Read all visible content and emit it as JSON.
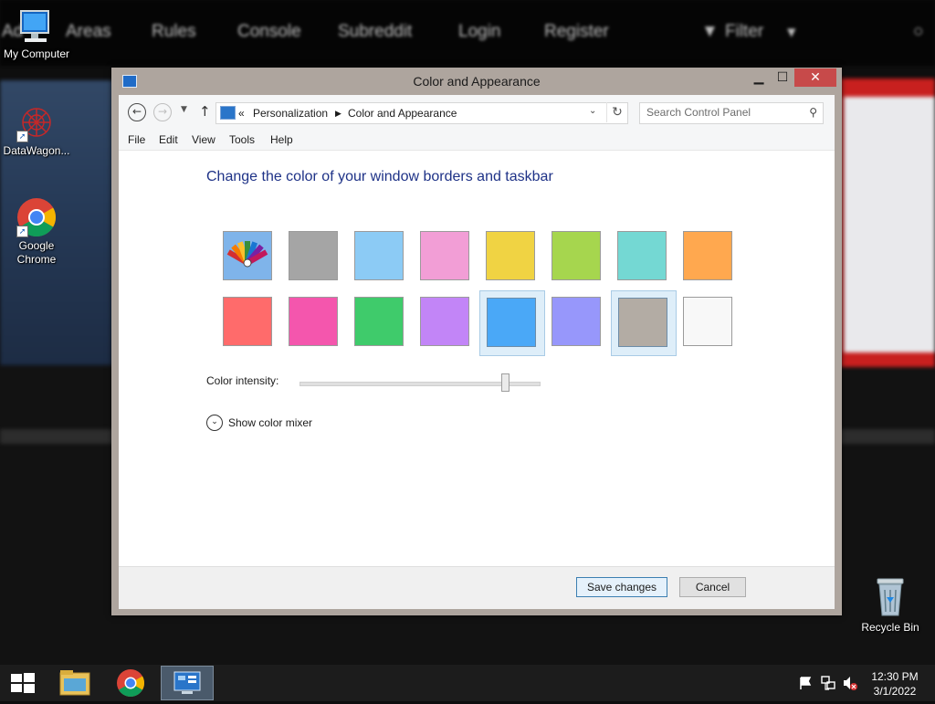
{
  "background": {
    "nav_items": [
      "Ad",
      "Areas",
      "Rules",
      "Console",
      "Subreddit",
      "Login",
      "Register",
      "Filter"
    ]
  },
  "desktop_icons": {
    "my_computer": "My Computer",
    "datawagon": "DataWagon...",
    "chrome": "Google Chrome",
    "recycle_bin": "Recycle Bin"
  },
  "window": {
    "title": "Color and Appearance",
    "address": {
      "chevron": "«",
      "crumb1": "Personalization",
      "crumb2": "Color and Appearance"
    },
    "search": {
      "placeholder": "Search Control Panel"
    },
    "menu": [
      "File",
      "Edit",
      "View",
      "Tools",
      "Help"
    ],
    "heading": "Change the color of your window borders and taskbar",
    "swatches": {
      "row1": [
        "auto",
        "#a5a5a5",
        "#8ccbf5",
        "#f29ed6",
        "#f0d343",
        "#a6d64e",
        "#74d8d3",
        "#ffa84f"
      ],
      "row2": [
        "#ff6b6b",
        "#f456ad",
        "#3fcb6b",
        "#c285f7",
        "#4aa8f7",
        "#9797fb",
        "#b3aca4",
        "#f8f8f8"
      ],
      "hover_index": 12,
      "selected_index": 14
    },
    "intensity": {
      "label": "Color intensity:",
      "value_fraction": 0.86
    },
    "mixer_label": "Show color mixer",
    "buttons": {
      "save": "Save changes",
      "cancel": "Cancel"
    }
  },
  "taskbar": {
    "clock_time": "12:30 PM",
    "clock_date": "3/1/2022"
  }
}
